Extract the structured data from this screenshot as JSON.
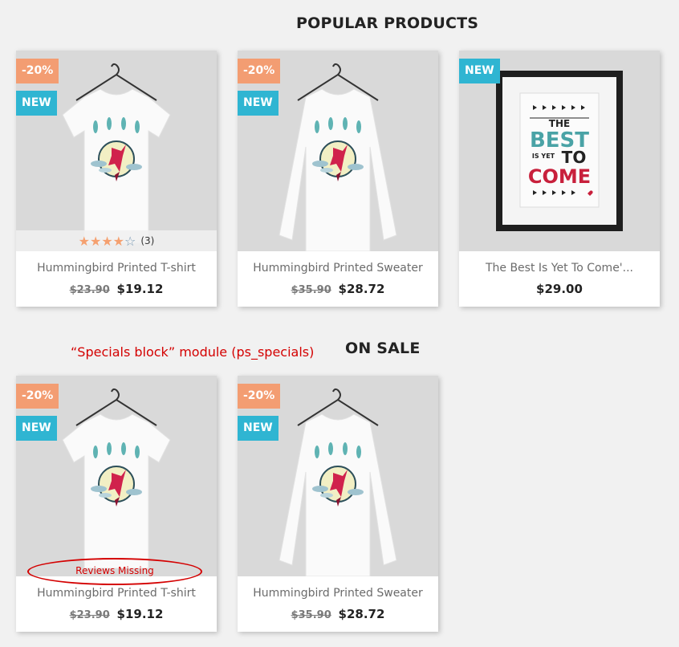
{
  "popular": {
    "title": "POPULAR PRODUCTS",
    "products": [
      {
        "name": "Hummingbird Printed T-shirt",
        "old_price": "$23.90",
        "price": "$19.12",
        "discount": "-20%",
        "new_label": "NEW",
        "image": "hummingbird-tshirt",
        "rating": 4,
        "rating_max": 5,
        "review_count": "(3)"
      },
      {
        "name": "Hummingbird Printed Sweater",
        "old_price": "$35.90",
        "price": "$28.72",
        "discount": "-20%",
        "new_label": "NEW",
        "image": "hummingbird-sweater"
      },
      {
        "name": "The Best Is Yet To Come'...",
        "price": "$29.00",
        "new_label": "NEW",
        "image": "framed-poster",
        "poster_text": {
          "line1": "THE",
          "line2": "BEST",
          "line3a": "IS YET",
          "line3b": "TO",
          "line4": "COME"
        }
      }
    ]
  },
  "on_sale": {
    "title": "ON SALE",
    "annotation": "“Specials block” module (ps_specials)",
    "reviews_missing": "Reviews Missing",
    "products": [
      {
        "name": "Hummingbird Printed T-shirt",
        "old_price": "$23.90",
        "price": "$19.12",
        "discount": "-20%",
        "new_label": "NEW",
        "image": "hummingbird-tshirt"
      },
      {
        "name": "Hummingbird Printed Sweater",
        "old_price": "$35.90",
        "price": "$28.72",
        "discount": "-20%",
        "new_label": "NEW",
        "image": "hummingbird-sweater"
      }
    ]
  },
  "colors": {
    "discount_flag": "#f39d72",
    "new_flag": "#2fb5d2",
    "annotation_red": "#d40000",
    "star_filled": "#f5a06f"
  }
}
